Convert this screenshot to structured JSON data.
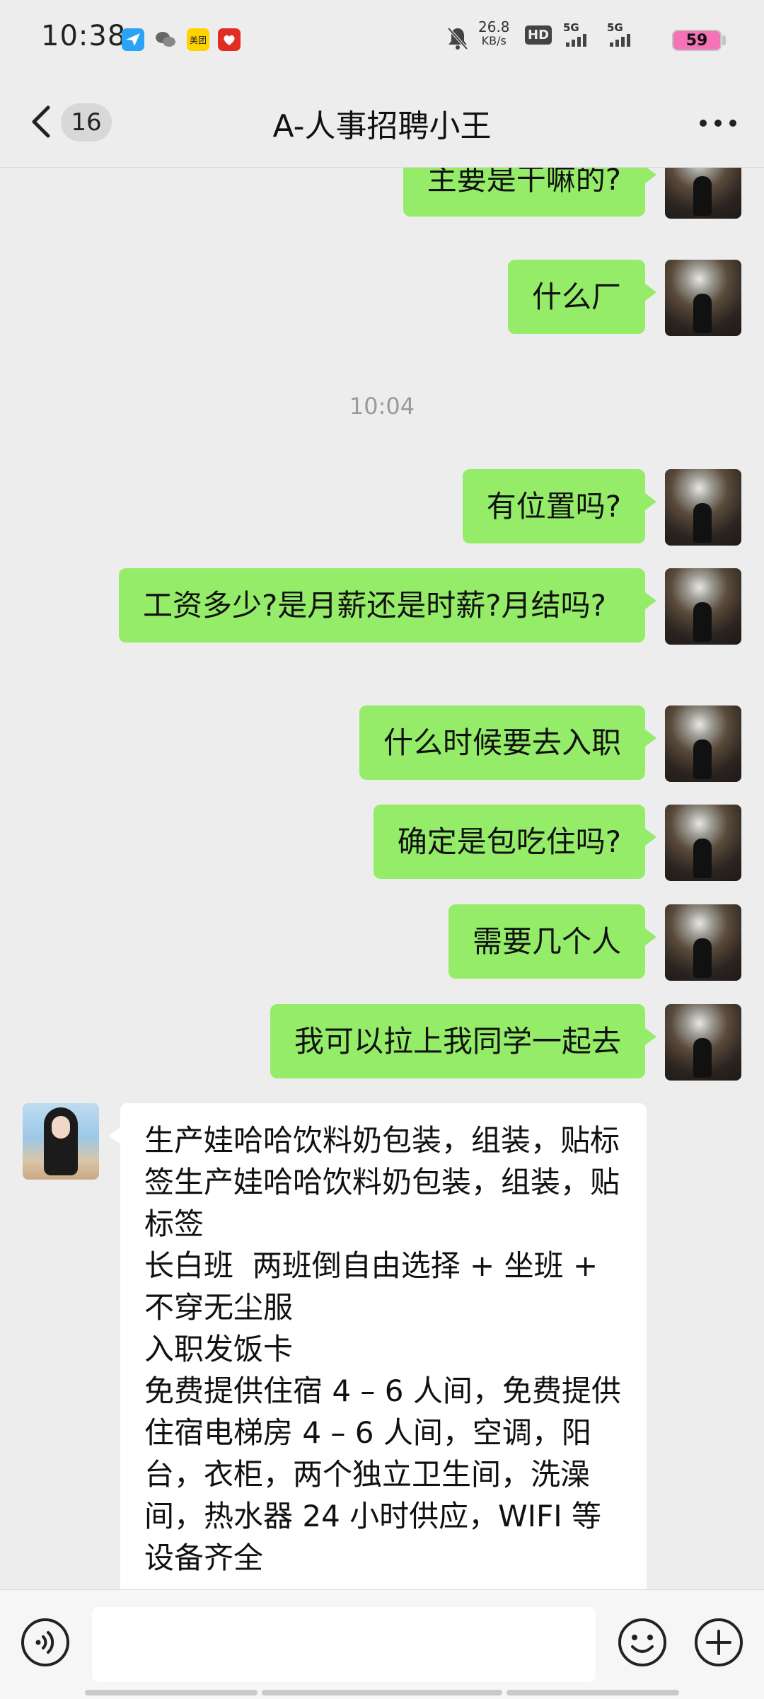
{
  "status_bar": {
    "time": "10:38",
    "app_icons": [
      "send-icon",
      "wechat-icon",
      "meituan-icon",
      "pinduoduo-icon"
    ],
    "meituan_label": "美团",
    "network_speed_value": "26.8",
    "network_speed_unit": "KB/s",
    "hd_label": "HD",
    "signal1_label": "5G",
    "signal2_label": "5G",
    "battery": "59"
  },
  "header": {
    "unread_count": "16",
    "title": "A-人事招聘小王"
  },
  "messages": [
    {
      "from": "self",
      "text": "主要是干嘛的?"
    },
    {
      "from": "self",
      "text": "什么厂"
    },
    {
      "type": "time",
      "text": "10:04"
    },
    {
      "from": "self",
      "text": "有位置吗?"
    },
    {
      "from": "self",
      "text": "工资多少?是月薪还是时薪?月结吗?"
    },
    {
      "from": "self",
      "text": "什么时候要去入职"
    },
    {
      "from": "self",
      "text": "确定是包吃住吗?"
    },
    {
      "from": "self",
      "text": "需要几个人"
    },
    {
      "from": "self",
      "text": "我可以拉上我同学一起去"
    },
    {
      "from": "other",
      "text": "生产娃哈哈饮料奶包装，组装，贴标签生产娃哈哈饮料奶包装，组装，贴标签\n长白班  两班倒自由选择 + 坐班 + 不穿无尘服\n入职发饭卡\n免费提供住宿 4 – 6 人间，免费提供住宿电梯房 4 – 6 人间，空调，阳台，衣柜，两个独立卫生间，洗澡间，热水器 24 小时供应，WIFI 等设备齐全"
    }
  ],
  "input": {
    "value": "",
    "placeholder": ""
  },
  "colors": {
    "self_bubble": "#95ec69",
    "other_bubble": "#ffffff",
    "background": "#ededed",
    "battery": "#f472b6"
  }
}
